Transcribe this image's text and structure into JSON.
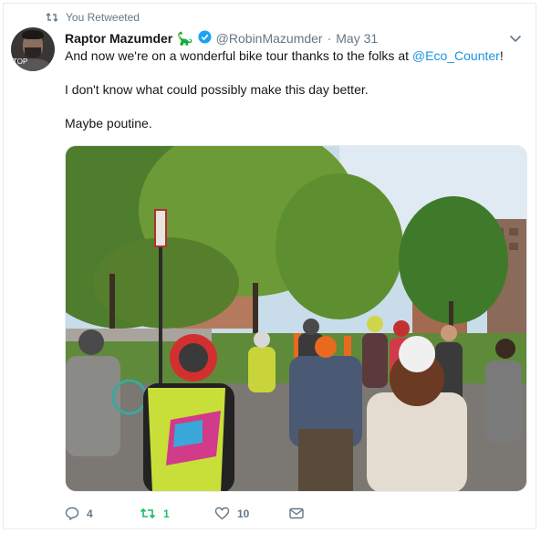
{
  "retweet_context": {
    "icon": "retweet-icon",
    "label": "You Retweeted"
  },
  "author": {
    "display_name": "Raptor Mazumder",
    "emoji": "🦕",
    "handle": "@RobinMazumder",
    "separator": "·",
    "date": "May 31",
    "verified": true,
    "avatar_tag": "TOP"
  },
  "tweet": {
    "line1_prefix": "And now we're on a wonderful bike tour thanks to the folks at ",
    "line1_mention": "@Eco_Counter",
    "line1_suffix": "!",
    "line2": "I don't know what could possibly make this day better.",
    "line3": "Maybe poutine."
  },
  "actions": {
    "reply_count": "4",
    "retweet_count": "1",
    "like_count": "10"
  },
  "colors": {
    "link": "#1b95e0",
    "secondary_text": "#657786",
    "retweet_active": "#17bf63",
    "verified": "#1da1f2",
    "border": "#e6ecf0"
  }
}
